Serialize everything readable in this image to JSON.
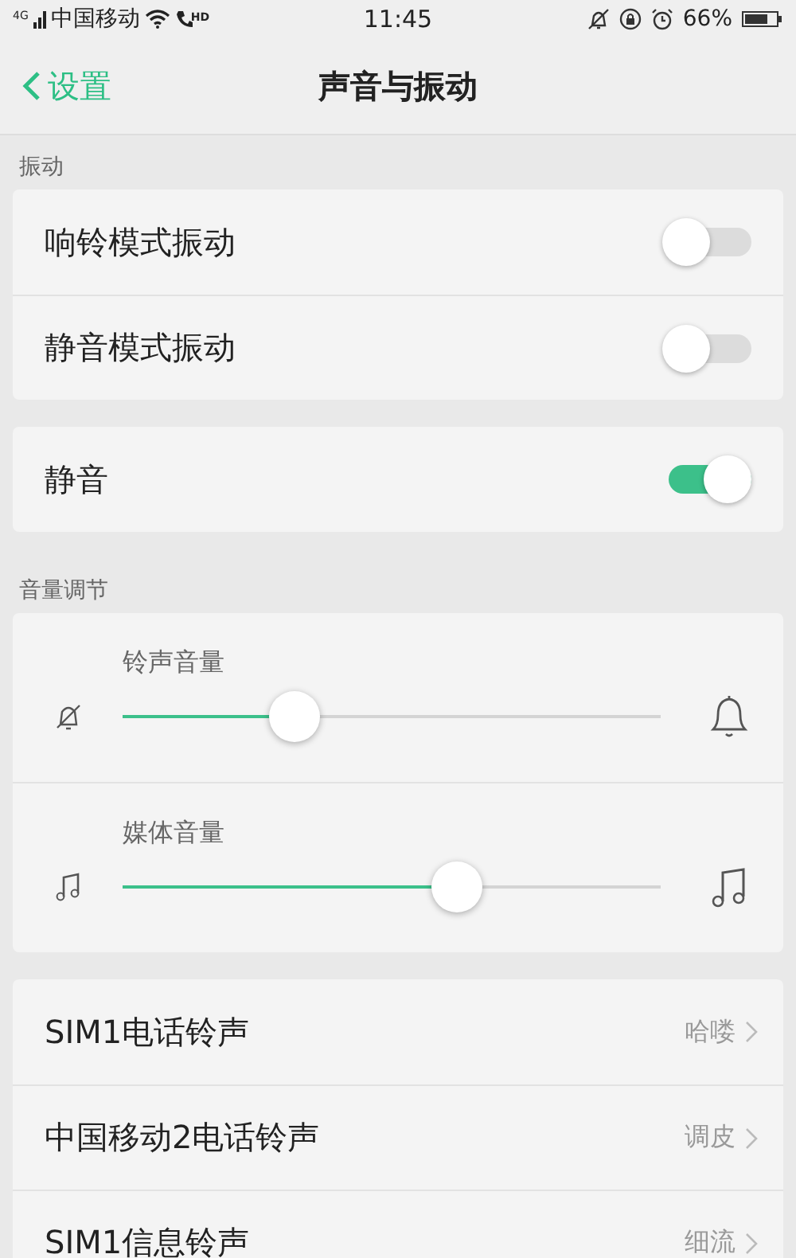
{
  "status_bar": {
    "network": "4G",
    "carrier": "中国移动",
    "hd": "HD",
    "time": "11:45",
    "battery": "66%"
  },
  "header": {
    "back": "设置",
    "title": "声音与振动"
  },
  "sections": [
    {
      "kind": "label",
      "text": "振动"
    },
    {
      "kind": "card",
      "rows": [
        {
          "kind": "toggle",
          "label": "响铃模式振动",
          "on": false
        },
        {
          "kind": "toggle",
          "label": "静音模式振动",
          "on": false
        }
      ]
    },
    {
      "kind": "card",
      "rows": [
        {
          "kind": "toggle",
          "label": "静音",
          "on": true
        }
      ]
    },
    {
      "kind": "label",
      "text": "音量调节"
    },
    {
      "kind": "card",
      "rows": [
        {
          "kind": "slider",
          "label": "铃声音量",
          "level": 0.32
        },
        {
          "kind": "slider",
          "label": "媒体音量",
          "level": 0.62
        }
      ]
    },
    {
      "kind": "card",
      "rows": [
        {
          "kind": "link",
          "label": "SIM1电话铃声",
          "value": "哈喽"
        },
        {
          "kind": "link",
          "label": "中国移动2电话铃声",
          "value": "调皮"
        },
        {
          "kind": "link",
          "label": "SIM1信息铃声",
          "value": "细流"
        }
      ]
    }
  ]
}
